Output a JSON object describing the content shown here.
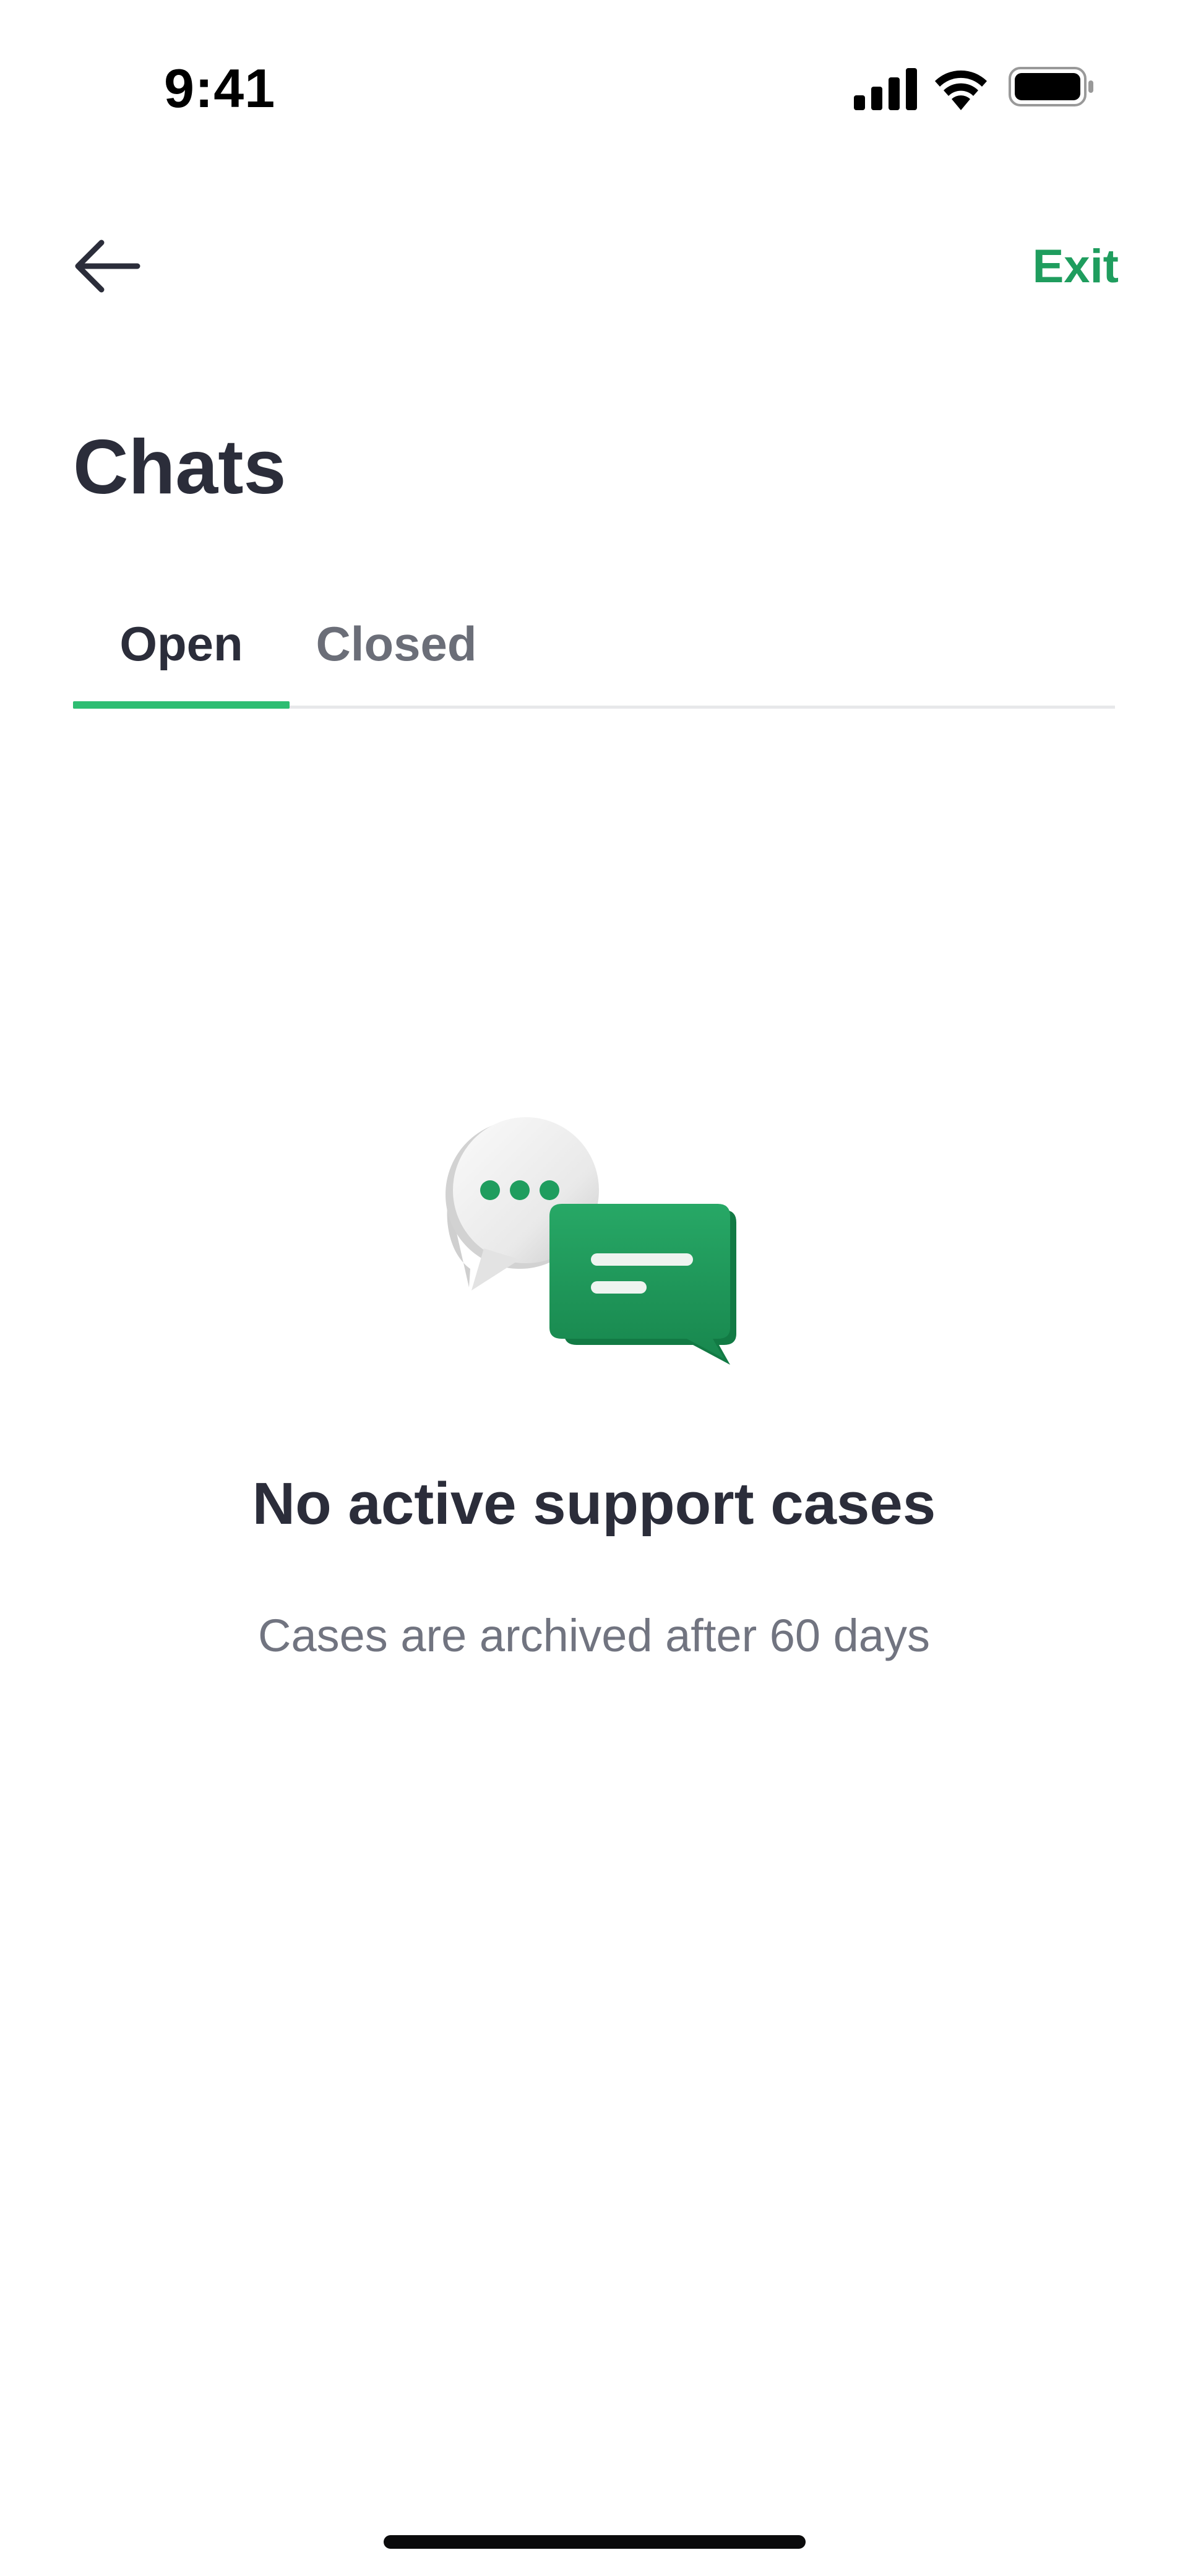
{
  "status_bar": {
    "time": "9:41",
    "icons": [
      "signal-icon",
      "wifi-icon",
      "battery-icon"
    ]
  },
  "nav": {
    "back_icon": "arrow-left-icon",
    "exit_label": "Exit"
  },
  "page": {
    "title": "Chats"
  },
  "tabs": [
    {
      "label": "Open",
      "active": true
    },
    {
      "label": "Closed",
      "active": false
    }
  ],
  "empty_state": {
    "illustration": "chat-bubbles-icon",
    "title": "No active support cases",
    "subtitle": "Cases are archived after 60 days"
  },
  "colors": {
    "accent": "#1f9d5e",
    "tab_indicator": "#2ebd72",
    "text_primary": "#2b2d3a",
    "text_secondary": "#717480"
  }
}
